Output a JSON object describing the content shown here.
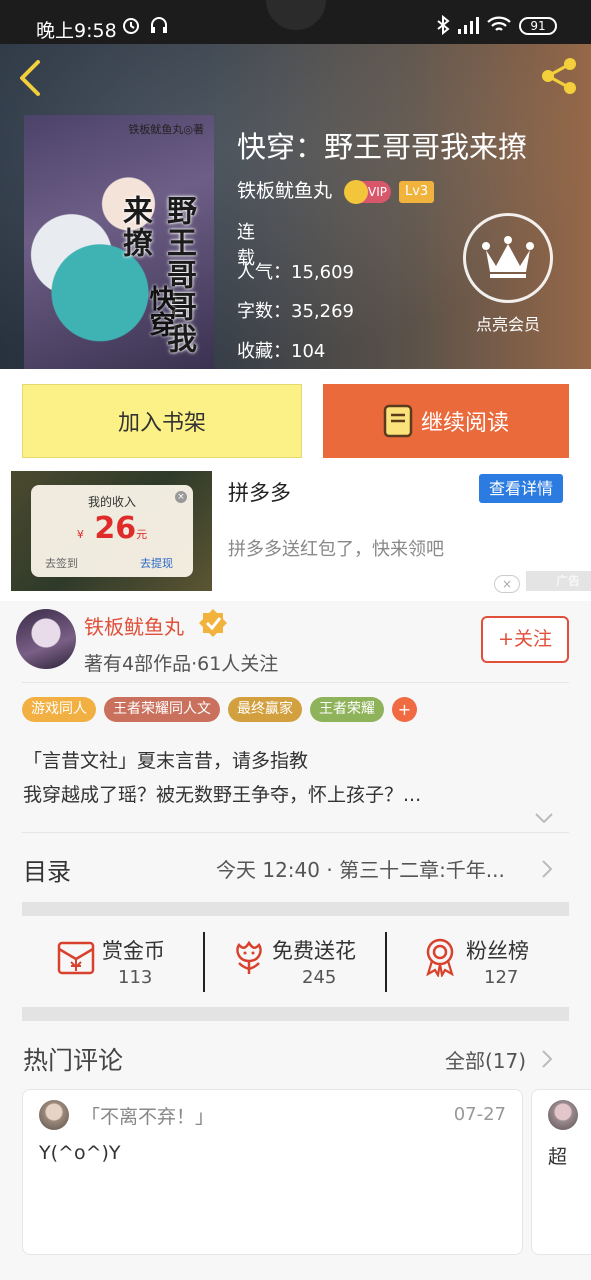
{
  "status_bar": {
    "time": "晚上9:58",
    "battery": "91"
  },
  "book": {
    "title": "快穿：野王哥哥我来撩",
    "author": "铁板鱿鱼丸",
    "vip_label": "VIP",
    "level": "Lv3",
    "status": "连载",
    "popularity_label": "人气：",
    "popularity": "15,609",
    "words_label": "字数：",
    "words": "35,269",
    "favorites_label": "收藏：",
    "favorites": "104",
    "cover_title": "野王哥哥我来撩",
    "cover_sub": "快穿",
    "cover_author": "铁板鱿鱼丸◎著"
  },
  "member": {
    "label": "点亮会员"
  },
  "actions": {
    "add_shelf": "加入书架",
    "continue_reading": "继续阅读"
  },
  "ad": {
    "title": "拼多多",
    "description": "拼多多送红包了，快来领吧",
    "detail_button": "查看详情",
    "tag": "广告",
    "card_title": "我的收入",
    "card_currency": "¥",
    "card_amount": "26",
    "card_unit": "元",
    "card_left": "去签到",
    "card_right": "去提现"
  },
  "author_section": {
    "name": "铁板鱿鱼丸",
    "meta": "著有4部作品·61人关注",
    "follow": "+关注"
  },
  "tags": [
    {
      "label": "游戏同人",
      "color": "#f3b042"
    },
    {
      "label": "王者荣耀同人文",
      "color": "#c9715d"
    },
    {
      "label": "最终赢家",
      "color": "#d3a040"
    },
    {
      "label": "王者荣耀",
      "color": "#8fb35a"
    }
  ],
  "intro": {
    "line1": "「言昔文社」夏末言昔，请多指教",
    "line2": "我穿越成了瑶？被无数野王争夺，怀上孩子？..."
  },
  "toc": {
    "label": "目录",
    "latest": "今天 12:40 · 第三十二章:千年..."
  },
  "support": [
    {
      "label": "赏金币",
      "count": "113",
      "icon": "coin-envelope-icon"
    },
    {
      "label": "免费送花",
      "count": "245",
      "icon": "flower-icon"
    },
    {
      "label": "粉丝榜",
      "count": "127",
      "icon": "ribbon-medal-icon"
    }
  ],
  "comments": {
    "title": "热门评论",
    "all": "全部(17)",
    "items": [
      {
        "quote": "「不离不弃！」",
        "date": "07-27",
        "body": "Y(^o^)Y"
      },
      {
        "body": "超"
      }
    ]
  },
  "colors": {
    "accent_orange": "#ea6a3c",
    "shelf_yellow": "#fbf187",
    "author_red": "#e0503a",
    "ad_blue": "#2c7be0"
  }
}
